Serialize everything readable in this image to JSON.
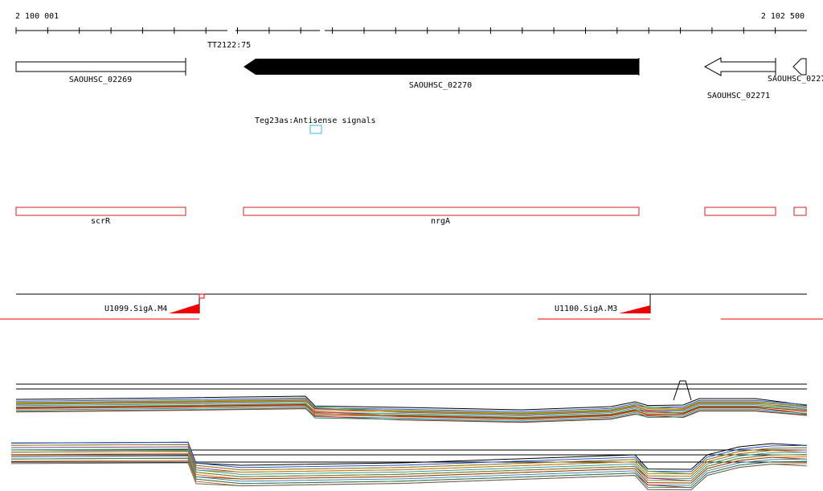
{
  "ruler": {
    "start_label": "2 100 001",
    "end_label": "2 102 500",
    "terminator_label": "TT2122:75"
  },
  "genes": [
    {
      "label": "SAOUHSC_02269",
      "style": "open",
      "strand": "+"
    },
    {
      "label": "SAOUHSC_02270",
      "style": "filled",
      "strand": "-"
    },
    {
      "label": "SAOUHSC_02271",
      "style": "open",
      "strand": "-"
    },
    {
      "label": "SAOUHSC_0227",
      "style": "open",
      "strand": "-"
    }
  ],
  "antisense": {
    "label": "Teg23as:Antisense signals",
    "color": "#33bbdd"
  },
  "operons": [
    {
      "label": "scrR"
    },
    {
      "label": "nrgA"
    },
    {
      "label": ""
    },
    {
      "label": ""
    }
  ],
  "promoters": [
    {
      "label": "U1099.SigA.M4"
    },
    {
      "label": "U1100.SigA.M3"
    }
  ],
  "colors": {
    "operon_red": "#cc2222",
    "promoter_red": "#ee0000",
    "gene_black": "#000000"
  }
}
